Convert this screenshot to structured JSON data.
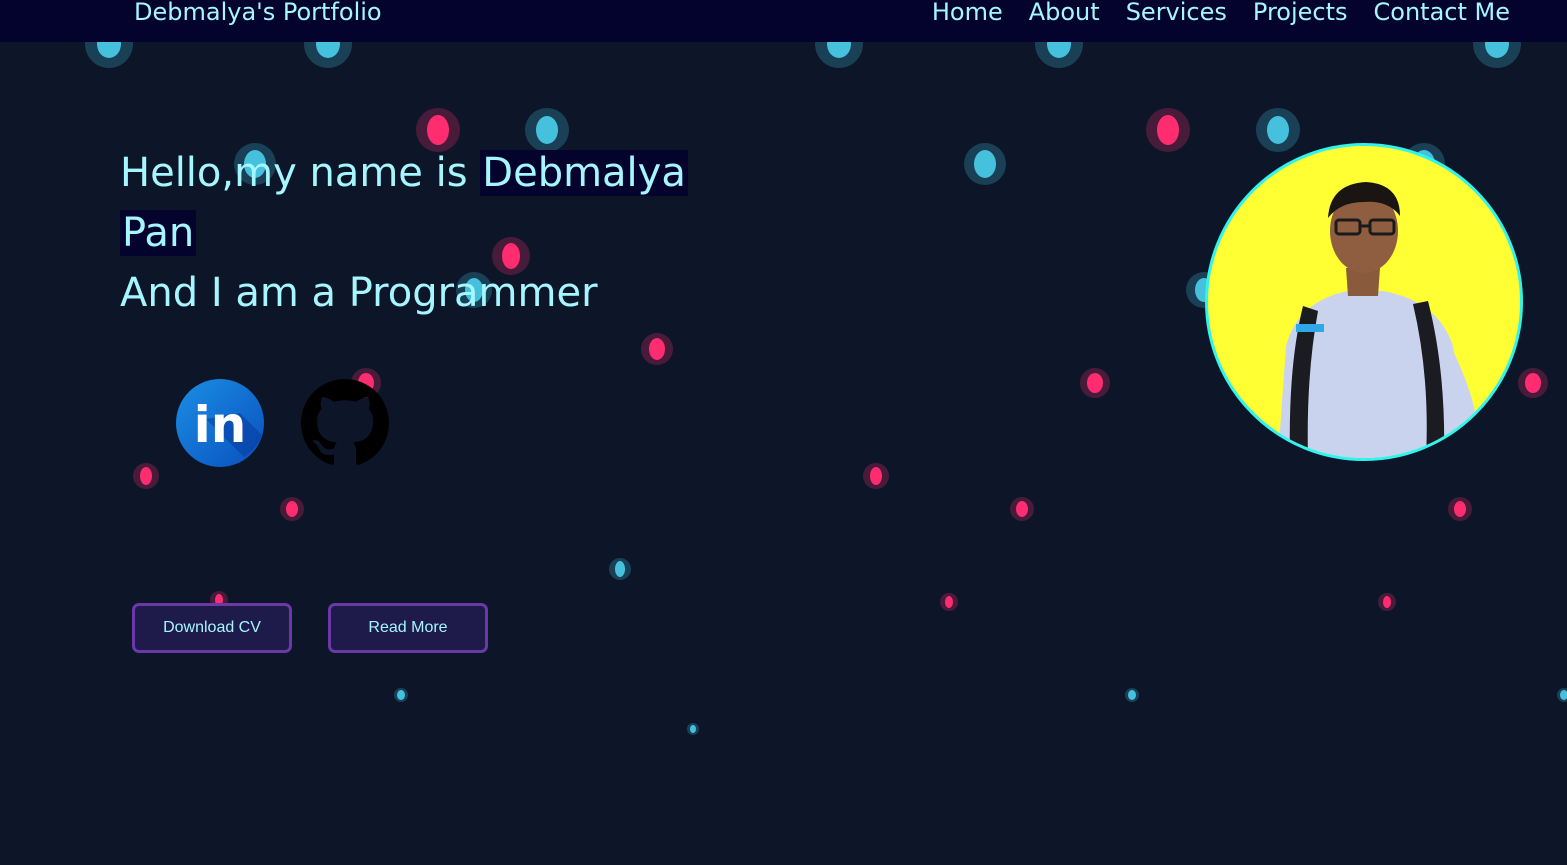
{
  "nav": {
    "brand": "Debmalya's Portfolio",
    "links": [
      "Home",
      "About",
      "Services",
      "Projects",
      "Contact Me"
    ]
  },
  "hero": {
    "greeting_prefix": "Hello,my name is ",
    "name_first": "Debmalya",
    "name_last": "Pan",
    "tagline": "And I am a Programmer"
  },
  "social": {
    "linkedin_icon": "linkedin-icon",
    "github_icon": "github-icon",
    "linkedin_text": "in"
  },
  "buttons": {
    "download_cv": "Download CV",
    "read_more": "Read More"
  },
  "colors": {
    "background": "#0d1628",
    "navbar": "#03032e",
    "text_accent": "#a6f6ff",
    "particle_blue": "#45c1de",
    "particle_pink": "#ff2d6f",
    "avatar_bg": "#ffff33",
    "avatar_border": "#2ff5ee",
    "button_border": "#6b38a8"
  }
}
